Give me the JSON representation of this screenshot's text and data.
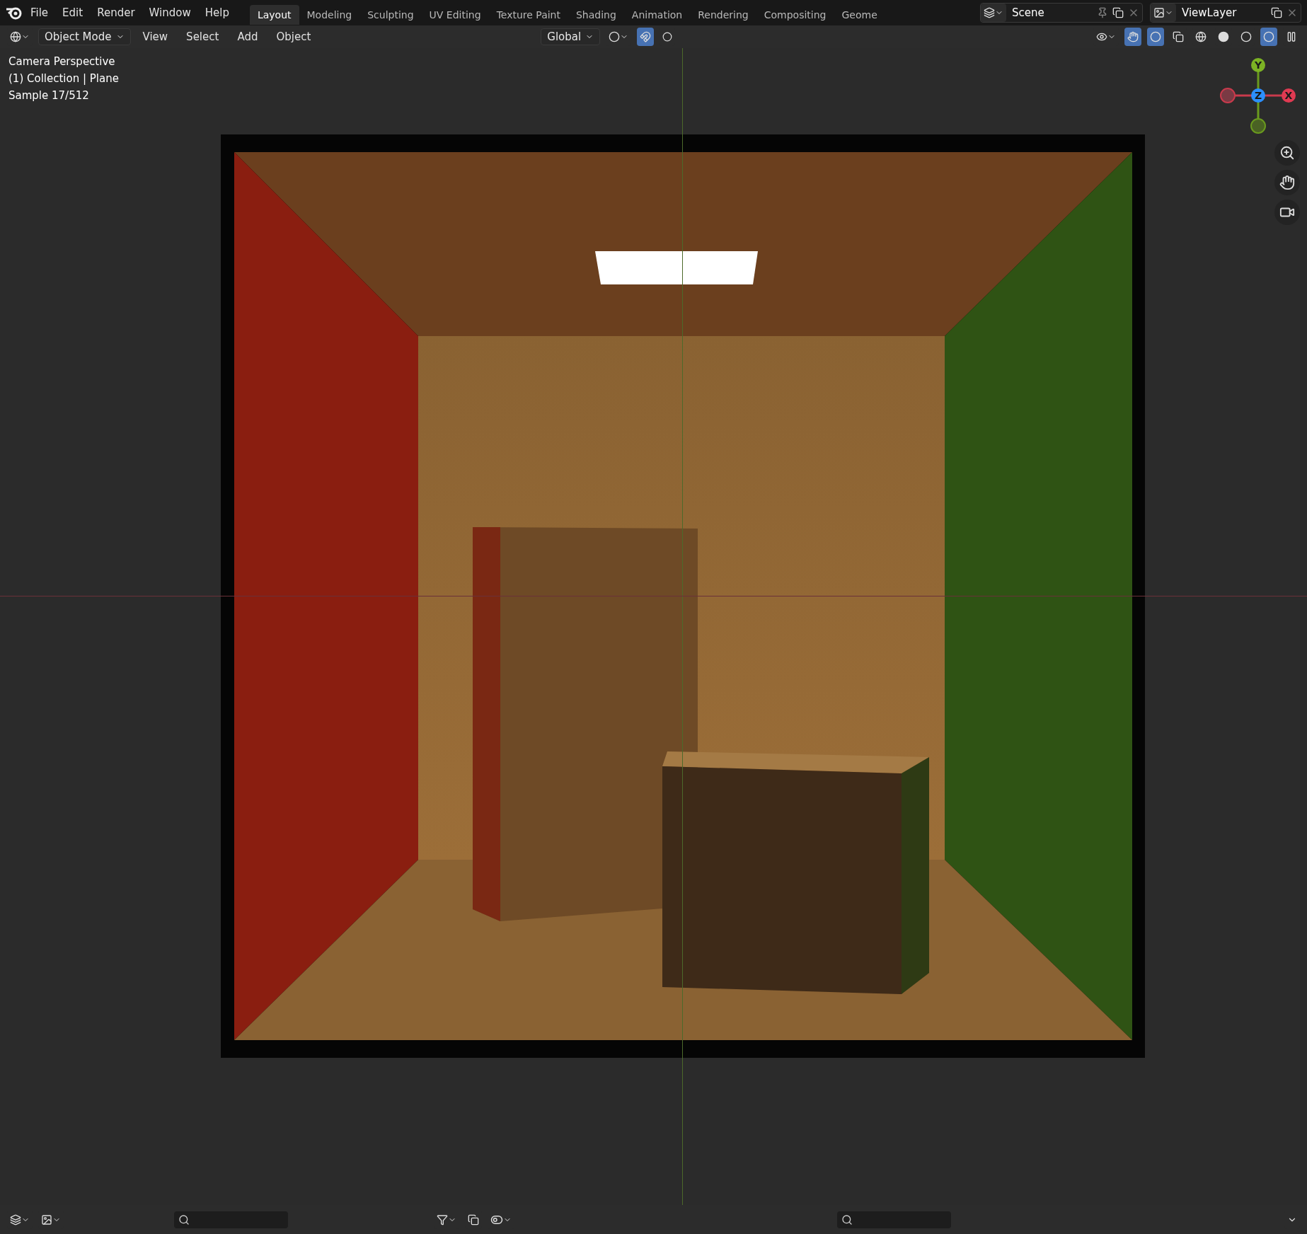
{
  "top_bar": {
    "menu": [
      "File",
      "Edit",
      "Render",
      "Window",
      "Help"
    ],
    "workspaces": [
      {
        "label": "Layout",
        "selected": true
      },
      {
        "label": "Modeling",
        "selected": false
      },
      {
        "label": "Sculpting",
        "selected": false
      },
      {
        "label": "UV Editing",
        "selected": false
      },
      {
        "label": "Texture Paint",
        "selected": false
      },
      {
        "label": "Shading",
        "selected": false
      },
      {
        "label": "Animation",
        "selected": false
      },
      {
        "label": "Rendering",
        "selected": false
      },
      {
        "label": "Compositing",
        "selected": false
      },
      {
        "label": "Geome",
        "selected": false
      }
    ],
    "scene": "Scene",
    "view_layer": "ViewLayer"
  },
  "header": {
    "mode": "Object Mode",
    "menu": [
      "View",
      "Select",
      "Add",
      "Object"
    ],
    "orientation": "Global",
    "toggles": {
      "snap": true,
      "proportional": false,
      "gizmos": true,
      "overlays": true,
      "xray": false
    },
    "shading": [
      {
        "selected": false
      },
      {
        "selected": false
      },
      {
        "selected": false
      },
      {
        "selected": true
      }
    ]
  },
  "viewport": {
    "info": [
      "Camera Perspective",
      "(1) Collection | Plane",
      "Sample 17/512"
    ],
    "gizmo": {
      "y": "Y",
      "z": "Z",
      "x": "X"
    }
  }
}
